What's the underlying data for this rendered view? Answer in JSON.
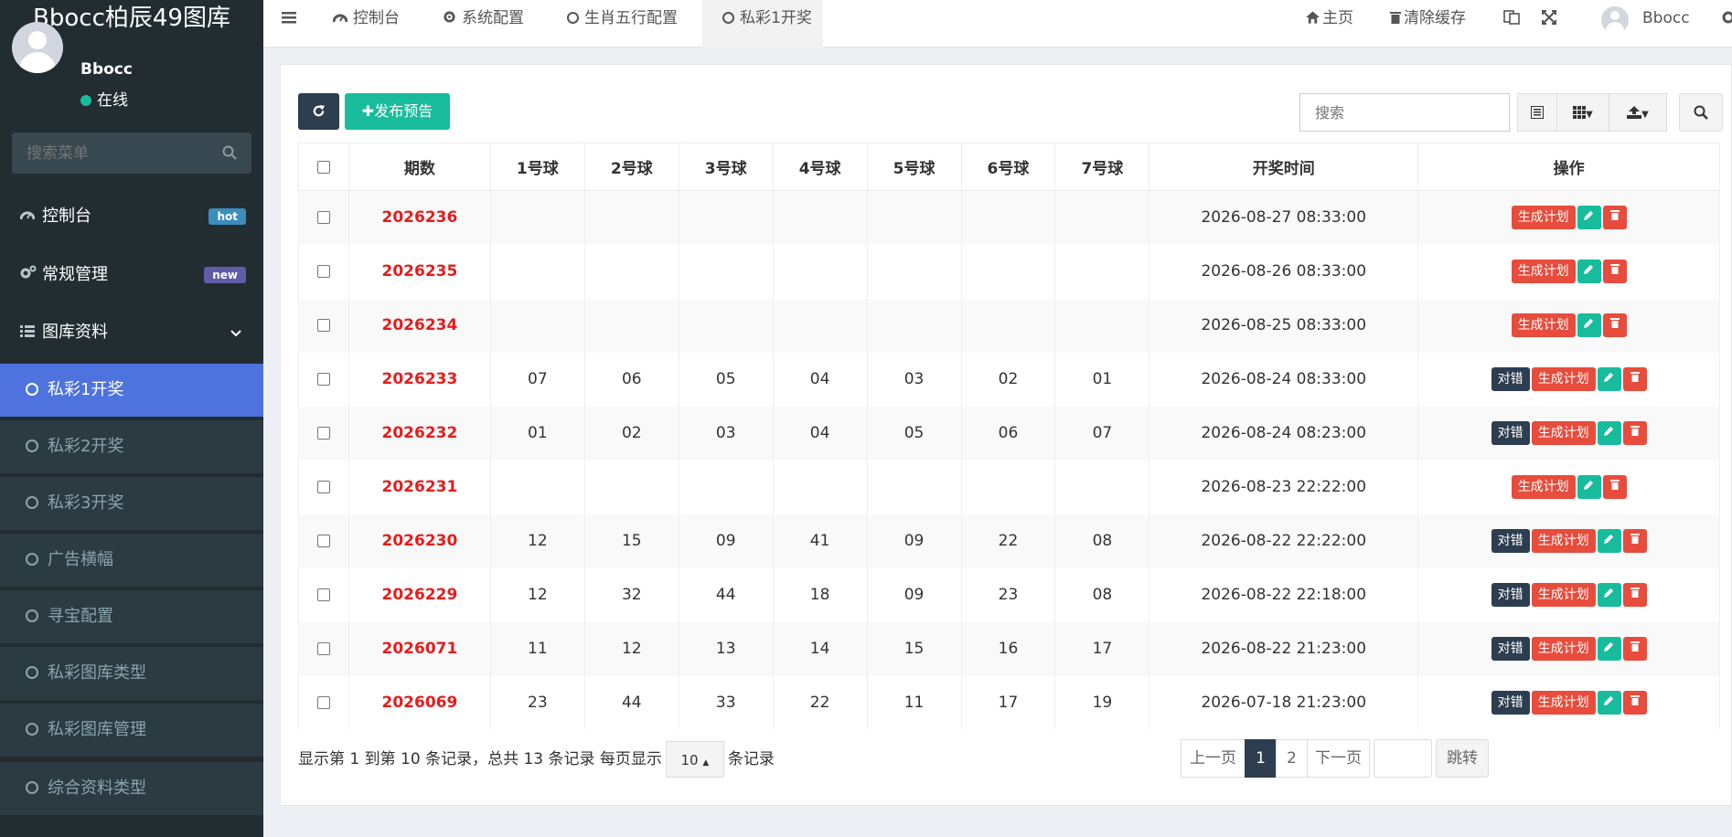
{
  "app": {
    "logo": "Bbocc柏辰49图库"
  },
  "user": {
    "name": "Bbocc",
    "status": "在线"
  },
  "sidebar": {
    "search_placeholder": "搜索菜单",
    "items": [
      {
        "label": "控制台",
        "badge": "hot",
        "badge_color": "#3c8dbc"
      },
      {
        "label": "常规管理",
        "badge": "new",
        "badge_color": "#605ca8"
      },
      {
        "label": "图库资料"
      }
    ],
    "sub_items": [
      {
        "label": "私彩1开奖",
        "active": true
      },
      {
        "label": "私彩2开奖"
      },
      {
        "label": "私彩3开奖"
      },
      {
        "label": "广告横幅"
      },
      {
        "label": "寻宝配置"
      },
      {
        "label": "私彩图库类型"
      },
      {
        "label": "私彩图库管理"
      },
      {
        "label": "综合资料类型"
      }
    ]
  },
  "topbar": {
    "tabs": [
      "控制台",
      "系统配置",
      "生肖五行配置",
      "私彩1开奖"
    ],
    "home": "主页",
    "clear_cache": "清除缓存",
    "username": "Bbocc"
  },
  "toolbar": {
    "publish": "发布预告",
    "search_placeholder": "搜索"
  },
  "table": {
    "headers": [
      "期数",
      "1号球",
      "2号球",
      "3号球",
      "4号球",
      "5号球",
      "6号球",
      "7号球",
      "开奖时间",
      "操作"
    ],
    "rows": [
      {
        "period": "2026236",
        "balls": [
          "",
          "",
          "",
          "",
          "",
          "",
          ""
        ],
        "time": "2026-08-27 08:33:00",
        "has_check": false
      },
      {
        "period": "2026235",
        "balls": [
          "",
          "",
          "",
          "",
          "",
          "",
          ""
        ],
        "time": "2026-08-26 08:33:00",
        "has_check": false
      },
      {
        "period": "2026234",
        "balls": [
          "",
          "",
          "",
          "",
          "",
          "",
          ""
        ],
        "time": "2026-08-25 08:33:00",
        "has_check": false
      },
      {
        "period": "2026233",
        "balls": [
          "07",
          "06",
          "05",
          "04",
          "03",
          "02",
          "01"
        ],
        "time": "2026-08-24 08:33:00",
        "has_check": true
      },
      {
        "period": "2026232",
        "balls": [
          "01",
          "02",
          "03",
          "04",
          "05",
          "06",
          "07"
        ],
        "time": "2026-08-24 08:23:00",
        "has_check": true
      },
      {
        "period": "2026231",
        "balls": [
          "",
          "",
          "",
          "",
          "",
          "",
          ""
        ],
        "time": "2026-08-23 22:22:00",
        "has_check": false
      },
      {
        "period": "2026230",
        "balls": [
          "12",
          "15",
          "09",
          "41",
          "09",
          "22",
          "08"
        ],
        "time": "2026-08-22 22:22:00",
        "has_check": true
      },
      {
        "period": "2026229",
        "balls": [
          "12",
          "32",
          "44",
          "18",
          "09",
          "23",
          "08"
        ],
        "time": "2026-08-22 22:18:00",
        "has_check": true
      },
      {
        "period": "2026071",
        "balls": [
          "11",
          "12",
          "13",
          "14",
          "15",
          "16",
          "17"
        ],
        "time": "2026-08-22 21:23:00",
        "has_check": true
      },
      {
        "period": "2026069",
        "balls": [
          "23",
          "44",
          "33",
          "22",
          "11",
          "17",
          "19"
        ],
        "time": "2026-07-18 21:23:00",
        "has_check": true
      }
    ],
    "actions": {
      "check": "对错",
      "plan": "生成计划"
    }
  },
  "pager": {
    "info_prefix": "显示第 1 到第 10 条记录，总共 13 条记录 每页显示",
    "page_size": "10",
    "info_suffix": "条记录",
    "prev": "上一页",
    "pages": [
      "1",
      "2"
    ],
    "next": "下一页",
    "jump": "跳转"
  }
}
